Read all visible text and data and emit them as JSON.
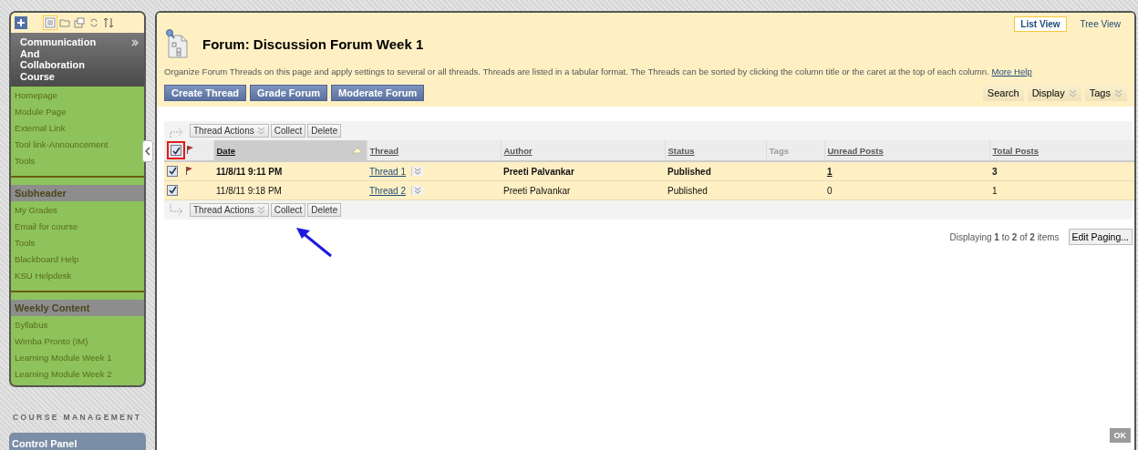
{
  "sidebar": {
    "course_title": "Communication And Collaboration Course",
    "menu": [
      {
        "kind": "link",
        "label": "Homepage"
      },
      {
        "kind": "link",
        "label": "Module Page"
      },
      {
        "kind": "link",
        "label": "External Link"
      },
      {
        "kind": "link",
        "label": "Tool link-Announcement"
      },
      {
        "kind": "link",
        "label": "Tools"
      },
      {
        "kind": "divider"
      },
      {
        "kind": "subheader",
        "label": "Subheader"
      },
      {
        "kind": "link",
        "label": "My Grades"
      },
      {
        "kind": "link",
        "label": "Email for course"
      },
      {
        "kind": "link",
        "label": "Tools"
      },
      {
        "kind": "link",
        "label": "Blackboard Help"
      },
      {
        "kind": "link",
        "label": "KSU Helpdesk"
      },
      {
        "kind": "divider"
      },
      {
        "kind": "subheader",
        "label": "Weekly Content"
      },
      {
        "kind": "link",
        "label": "Syllabus"
      },
      {
        "kind": "link",
        "label": "Wimba Pronto (IM)"
      },
      {
        "kind": "link",
        "label": "Learning Module Week 1"
      },
      {
        "kind": "link",
        "label": "Learning Module Week 2"
      }
    ],
    "section_title": "COURSE MANAGEMENT",
    "panel": "Control Panel"
  },
  "views": [
    {
      "label": "List View",
      "selected": true
    },
    {
      "label": "Tree View",
      "selected": false
    }
  ],
  "title": "Forum: Discussion Forum Week 1",
  "description": "Organize Forum Threads on this page and apply settings to several or all threads. Threads are listed in a tabular format. The Threads can be sorted by clicking the column title or the caret at the top of each column.",
  "help_link": "More Help",
  "buttons": [
    "Create Thread",
    "Grade Forum",
    "Moderate Forum"
  ],
  "tools": [
    {
      "label": "Search",
      "dropdown": false
    },
    {
      "label": "Display",
      "dropdown": true
    },
    {
      "label": "Tags",
      "dropdown": true
    }
  ],
  "action_bars": [
    {
      "menu": "Thread Actions",
      "buttons": [
        "Collect",
        "Delete"
      ]
    },
    {
      "menu": "Thread Actions",
      "buttons": [
        "Collect",
        "Delete"
      ]
    }
  ],
  "table": {
    "all_checked": true,
    "columns": [
      {
        "label": "Date",
        "sortable": true,
        "sorted": true
      },
      {
        "label": "Thread",
        "sortable": true,
        "sorted": false
      },
      {
        "label": "Author",
        "sortable": true,
        "sorted": false
      },
      {
        "label": "Status",
        "sortable": true,
        "sorted": false
      },
      {
        "label": "Tags",
        "sortable": false,
        "sorted": false
      },
      {
        "label": "Unread Posts",
        "sortable": true,
        "sorted": false
      },
      {
        "label": "Total Posts",
        "sortable": true,
        "sorted": false
      }
    ],
    "rows": [
      {
        "checked": true,
        "flagged": true,
        "unread": true,
        "date": "11/8/11 9:11 PM",
        "thread": "Thread 1",
        "author": "Preeti Palvankar",
        "status": "Published",
        "unread_posts": "1",
        "total_posts": "3"
      },
      {
        "checked": true,
        "flagged": false,
        "unread": false,
        "date": "11/8/11 9:18 PM",
        "thread": "Thread 2",
        "author": "Preeti Palvankar",
        "status": "Published",
        "unread_posts": "0",
        "total_posts": "1"
      }
    ]
  },
  "paging": {
    "text": "Displaying **1** to **2** of **2** items",
    "button": "Edit Paging..."
  },
  "ok_button": {
    "label": "OK",
    "disabled": true
  }
}
